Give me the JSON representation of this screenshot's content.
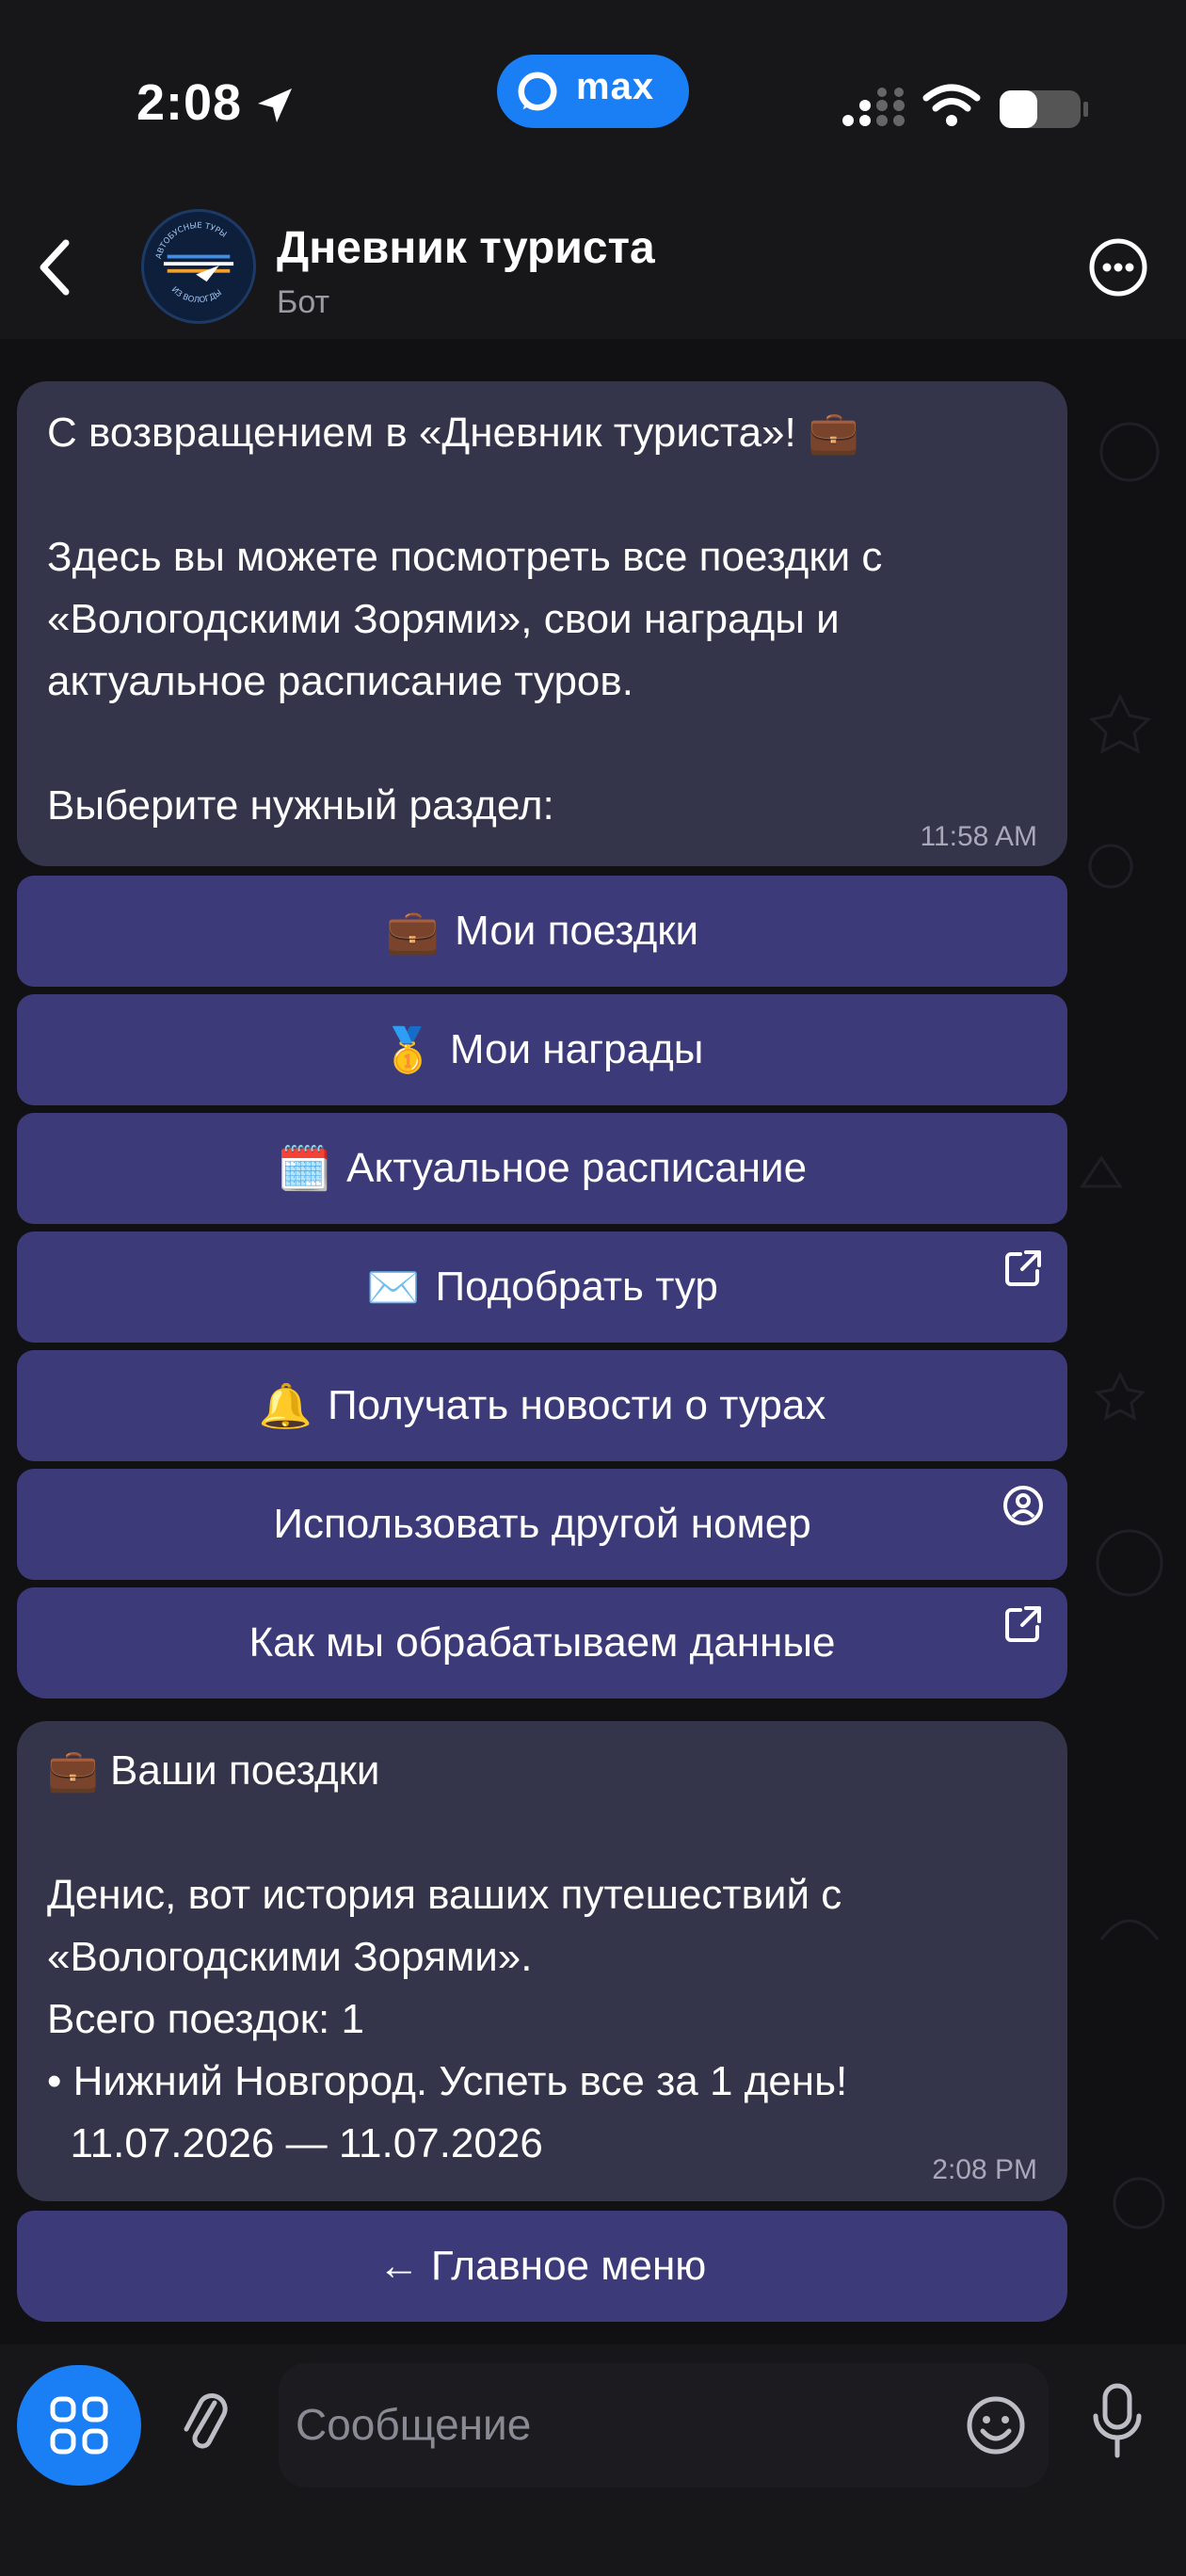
{
  "status_bar": {
    "time": "2:08",
    "app_badge": "max",
    "colors": {
      "accent": "#1a7ef5"
    }
  },
  "header": {
    "title": "Дневник туриста",
    "subtitle": "Бот",
    "avatar_text_top": "АВТОБУСНЫЕ ТУРЫ",
    "avatar_text_bottom": "ИЗ ВОЛОГДЫ"
  },
  "messages": [
    {
      "text": "С возвращением в «Дневник туриста»! 💼\n\nЗдесь вы можете посмотреть все поездки с\n«Вологодскими Зорями», свои награды и\nактуальное расписание туров.\n\nВыберите нужный раздел:",
      "time": "11:58 AM"
    },
    {
      "text": "💼 Ваши поездки\n\nДенис, вот история ваших путешествий с\n«Вологодскими Зорями».\nВсего поездок: 1\n• Нижний Новгород. Успеть все за 1 день!\n  11.07.2026 — 11.07.2026",
      "time": "2:08 PM"
    }
  ],
  "keyboard": [
    {
      "emoji": "💼",
      "label": "Мои поездки",
      "icon": ""
    },
    {
      "emoji": "🥇",
      "label": "Мои награды",
      "icon": ""
    },
    {
      "emoji": "🗓️",
      "label": "Актуальное расписание",
      "icon": ""
    },
    {
      "emoji": "✉️",
      "label": "Подобрать тур",
      "icon": "external-link-icon"
    },
    {
      "emoji": "🔔",
      "label": "Получать новости о турах",
      "icon": ""
    },
    {
      "emoji": "",
      "label": "Использовать другой номер",
      "icon": "contact-icon"
    },
    {
      "emoji": "",
      "label": "Как мы обрабатываем данные",
      "icon": "external-link-icon"
    }
  ],
  "back_button": {
    "label": "← Главное меню"
  },
  "input": {
    "placeholder": "Сообщение"
  }
}
